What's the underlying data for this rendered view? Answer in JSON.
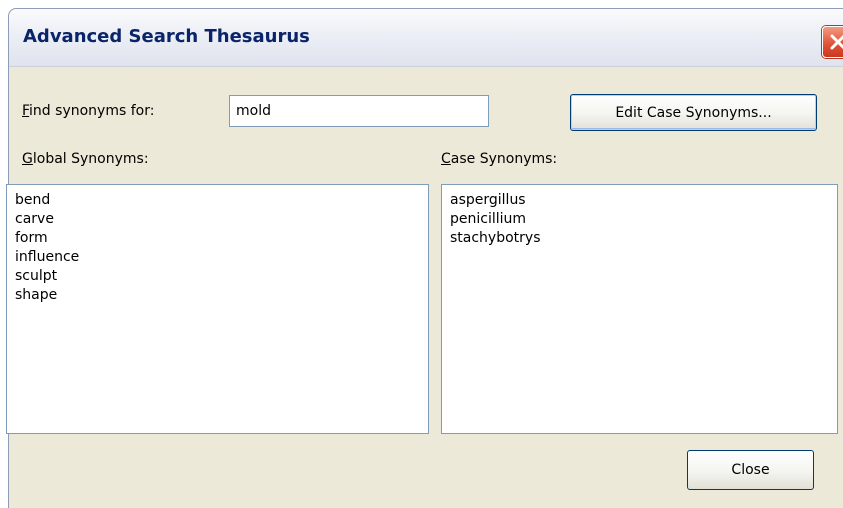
{
  "window": {
    "title": "Advanced Search Thesaurus",
    "close_icon": "close-icon",
    "close_color": "#e2553a"
  },
  "find": {
    "label_accel": "F",
    "label_rest": "ind synonyms for:",
    "value": "mold"
  },
  "buttons": {
    "edit_case_synonyms": "Edit Case Synonyms...",
    "close": "Close"
  },
  "global_synonyms": {
    "label_accel": "G",
    "label_rest": "lobal Synonyms:",
    "items": [
      "bend",
      "carve",
      "form",
      "influence",
      "sculpt",
      "shape"
    ]
  },
  "case_synonyms": {
    "label_accel": "C",
    "label_rest": "ase Synonyms:",
    "items": [
      "aspergillus",
      "penicillium",
      "stachybotrys"
    ]
  }
}
